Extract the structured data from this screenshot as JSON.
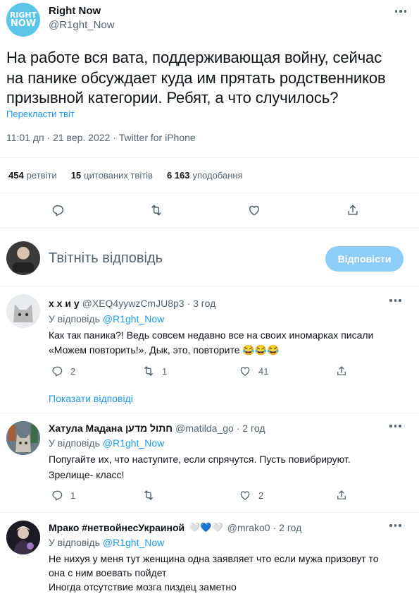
{
  "tweet": {
    "author_name": "Right Now",
    "author_handle": "@R1ght_Now",
    "logo_text_1": "RIGHT",
    "logo_text_2": "NOW",
    "text_line1": "На работе вся вата, поддерживающая войну, сейчас",
    "text_line2": "на панике обсуждает куда им прятать родственников",
    "text_line3": "призывной категории. Ребят, а что случилось?",
    "translate_label": "Перекласти твіт",
    "timestamp": "11:01 дп · 21 вер. 2022 · Twitter for iPhone",
    "stats": {
      "retweets_count": "454",
      "retweets_label": "ретвіти",
      "quotes_count": "15",
      "quotes_label": "цитованих твітів",
      "likes_count": "6 163",
      "likes_label": "уподобання"
    }
  },
  "compose": {
    "placeholder": "Твітніть відповідь",
    "button_label": "Відповісти"
  },
  "replies": [
    {
      "name": "х х и у",
      "handle": "@XEQ4yywzCmJU8p3",
      "time": "· 3 год",
      "reply_to_prefix": "У відповідь",
      "reply_to_handle": "@R1ght_Now",
      "line1": "Как так паника?! Ведь совсем недавно все на своих иномарках писали",
      "line2": "«Можем повторить!». Дык, это, повторите 😂😂😂",
      "line3": "",
      "replies": "2",
      "retweets": "1",
      "likes": "41",
      "show_replies": "Показати відповіді"
    },
    {
      "name": "Хатула Мадана חתול מדען",
      "handle": "@matilda_go",
      "time": "· 2 год",
      "reply_to_prefix": "У відповідь",
      "reply_to_handle": "@R1ght_Now",
      "line1": "Попугайте их, что наступите, если спрячутся. Пусть повибрируют.",
      "line2": "Зрелище- класс!",
      "line3": "",
      "replies": "1",
      "retweets": "",
      "likes": "2"
    },
    {
      "name": "Мрако #нетвойнесУкраиной",
      "handle": "@mrako0",
      "time": "· 2 год",
      "reply_to_prefix": "У відповідь",
      "reply_to_handle": "@R1ght_Now",
      "line1": "Не нихуя у меня тут женщина одна заявляет что если мужа призовут то",
      "line2": "она с ним воевать пойдет",
      "line3": "Иногда отсутствие мозга пиздец заметно",
      "hearts": "🤍💙🤍"
    }
  ],
  "colors": {
    "accent": "#1d9bf0",
    "button_disabled": "#8ecdf8",
    "muted": "#536471",
    "logo_bg": "#5bc6e8"
  }
}
